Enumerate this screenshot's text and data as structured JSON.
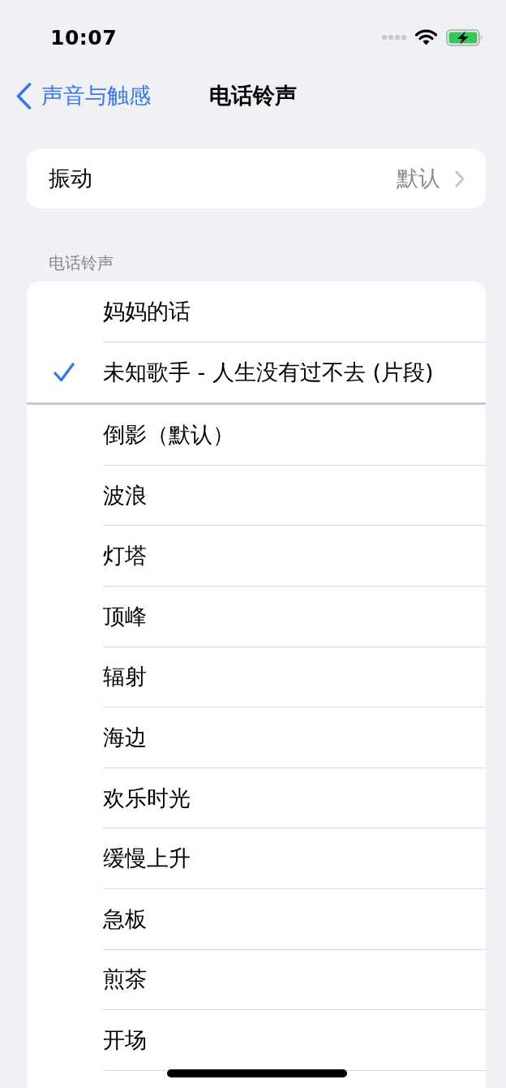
{
  "status_bar": {
    "time": "10:07"
  },
  "nav_bar": {
    "back_label": "声音与触感",
    "title": "电话铃声"
  },
  "vibration": {
    "label": "振动",
    "value": "默认"
  },
  "ringtones": {
    "header": "电话铃声",
    "groups": [
      {
        "items": [
          {
            "name": "妈妈的话",
            "selected": false
          },
          {
            "name": "未知歌手 - 人生没有过不去 (片段)",
            "selected": true
          }
        ]
      },
      {
        "items": [
          {
            "name": "倒影（默认）",
            "selected": false
          },
          {
            "name": "波浪",
            "selected": false
          },
          {
            "name": "灯塔",
            "selected": false
          },
          {
            "name": "顶峰",
            "selected": false
          },
          {
            "name": "辐射",
            "selected": false
          },
          {
            "name": "海边",
            "selected": false
          },
          {
            "name": "欢乐时光",
            "selected": false
          },
          {
            "name": "缓慢上升",
            "selected": false
          },
          {
            "name": "急板",
            "selected": false
          },
          {
            "name": "煎茶",
            "selected": false
          },
          {
            "name": "开场",
            "selected": false
          }
        ]
      }
    ]
  }
}
